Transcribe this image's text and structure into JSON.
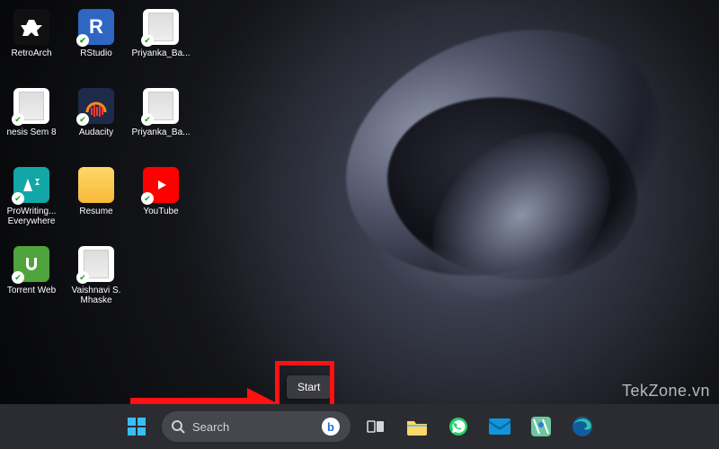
{
  "desktop_icons": [
    {
      "label": "RetroArch",
      "kind": "retroarch"
    },
    {
      "label": "RStudio",
      "kind": "rstudio"
    },
    {
      "label": "Priyanka_Ba...",
      "kind": "doc"
    },
    {
      "label": "nesis Sem 8",
      "kind": "doc"
    },
    {
      "label": "Audacity",
      "kind": "audacity"
    },
    {
      "label": "Priyanka_Ba...",
      "kind": "doc"
    },
    {
      "label": "ProWriting... Everywhere",
      "kind": "prowrite"
    },
    {
      "label": "Resume",
      "kind": "folder"
    },
    {
      "label": "YouTube",
      "kind": "youtube"
    },
    {
      "label": "Torrent Web",
      "kind": "utorrent"
    },
    {
      "label": "Vaishnavi S. Mhaske",
      "kind": "doc"
    }
  ],
  "tooltip": {
    "start": "Start"
  },
  "search": {
    "placeholder": "Search",
    "icon": "search",
    "bing_label": "b"
  },
  "taskbar_items": [
    {
      "name": "start",
      "icon": "windows"
    },
    {
      "name": "search",
      "icon": "searchbox"
    },
    {
      "name": "taskview",
      "icon": "taskview"
    },
    {
      "name": "explorer",
      "icon": "folder"
    },
    {
      "name": "whatsapp",
      "icon": "whatsapp"
    },
    {
      "name": "mail",
      "icon": "mail"
    },
    {
      "name": "maps",
      "icon": "maps"
    },
    {
      "name": "edge",
      "icon": "edge"
    }
  ],
  "watermark": "TekZone.vn",
  "annotation": {
    "highlight": "start-button",
    "color": "#ff1111"
  }
}
